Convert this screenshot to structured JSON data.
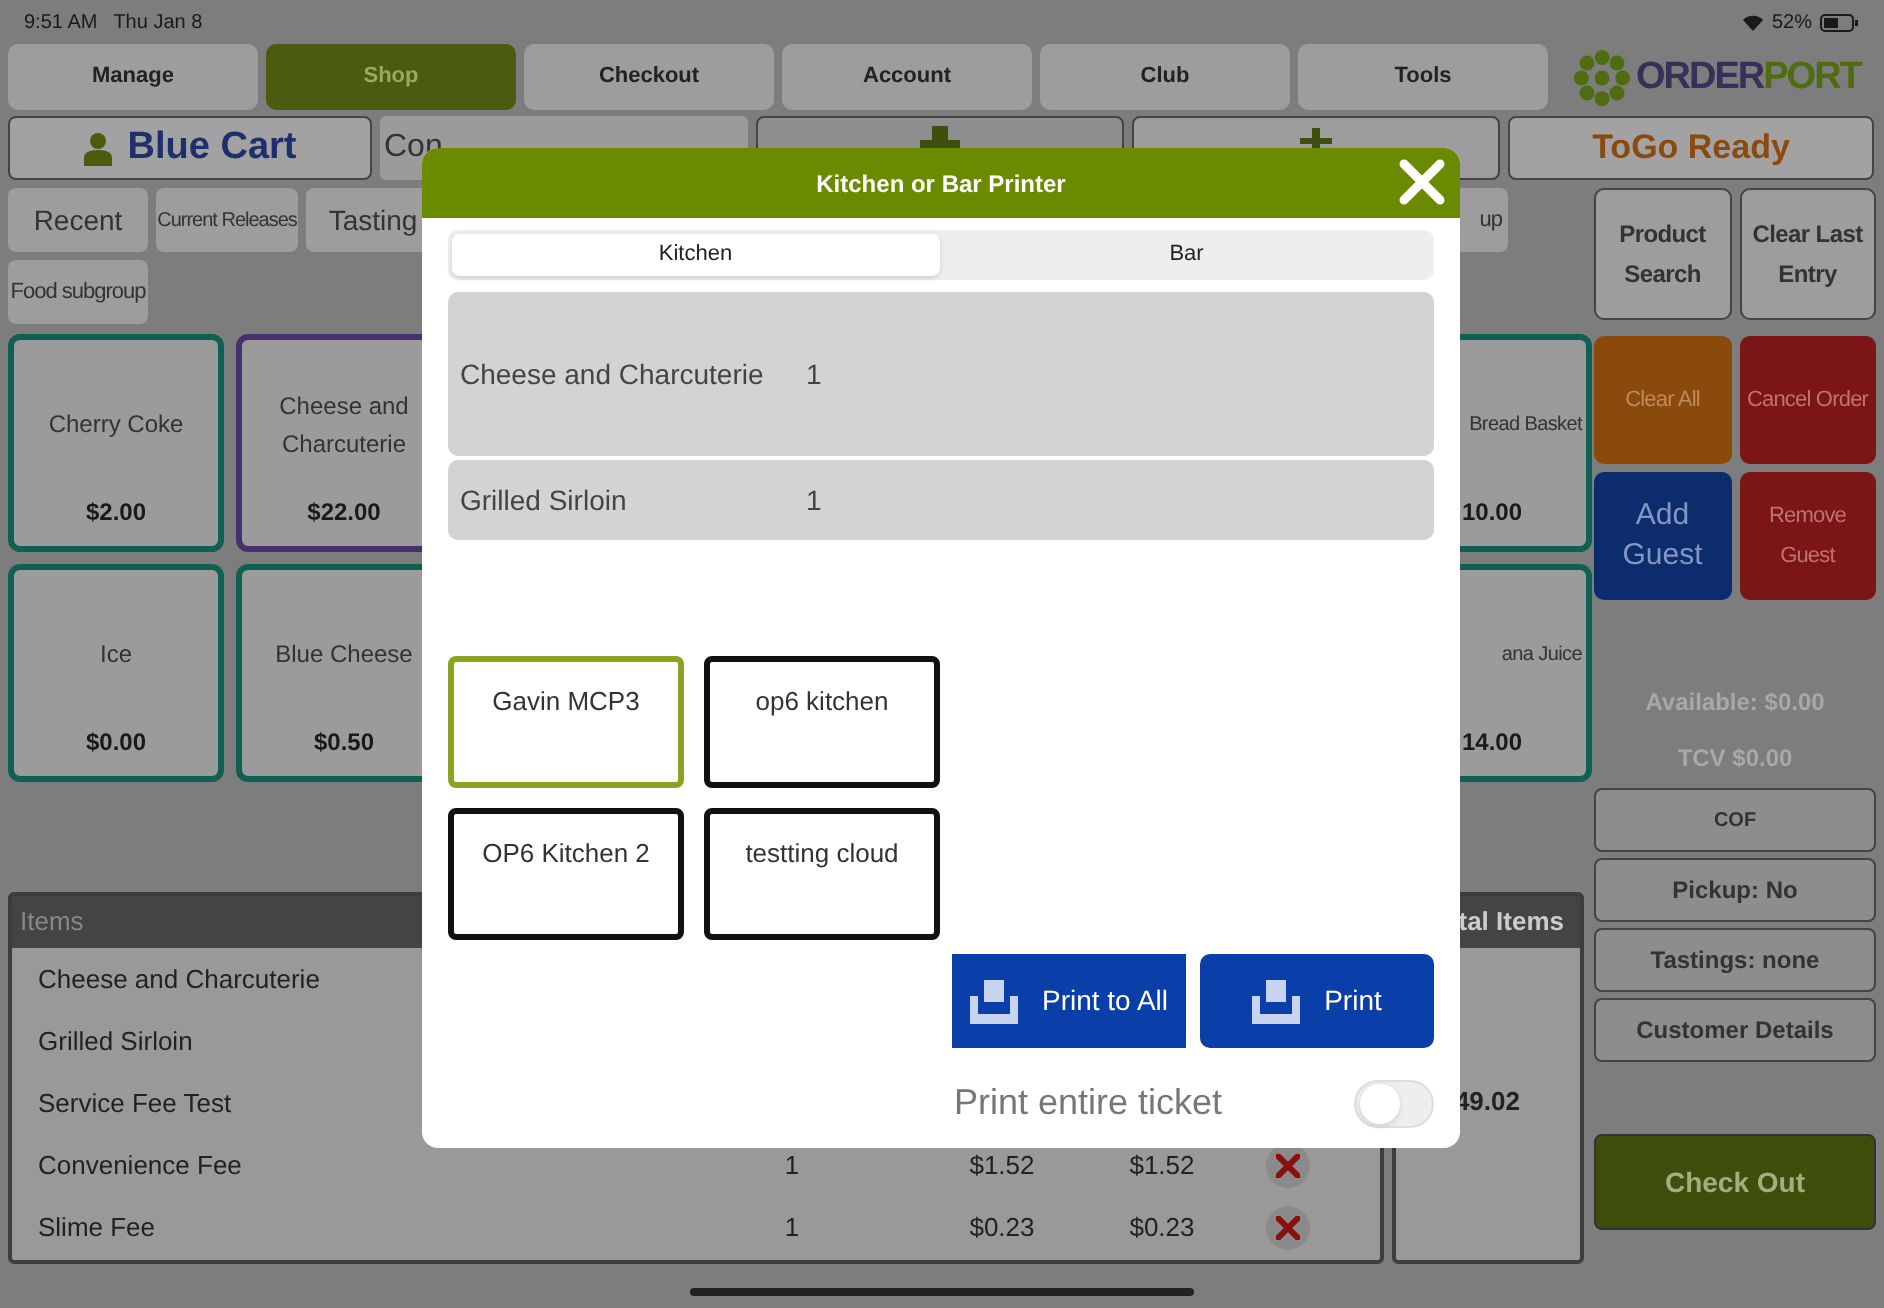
{
  "status_bar": {
    "time": "9:51 AM",
    "date": "Thu Jan 8",
    "battery": "52%"
  },
  "nav_tabs": [
    {
      "label": "Manage",
      "selected": false
    },
    {
      "label": "Shop",
      "selected": true
    },
    {
      "label": "Checkout",
      "selected": false
    },
    {
      "label": "Account",
      "selected": false
    },
    {
      "label": "Club",
      "selected": false
    },
    {
      "label": "Tools",
      "selected": false
    }
  ],
  "logo": {
    "part_1": "ORDER",
    "part_2": "PORT"
  },
  "customer_bar": {
    "cart": "Blue Cart",
    "customer_field": "Con",
    "togo": "ToGo Ready"
  },
  "categories": [
    {
      "label": "Recent"
    },
    {
      "label": "Current Releases"
    },
    {
      "label": "Tasting"
    },
    {
      "label": "up"
    },
    {
      "label": "Food subgroup"
    }
  ],
  "products": [
    {
      "name": "Cherry Coke",
      "price": "$2.00",
      "color": "#0f5f52"
    },
    {
      "name": "Cheese and Charcuterie",
      "price": "$22.00",
      "color": "#46306e"
    },
    {
      "name": "Bread Basket",
      "price": "10.00",
      "color": "#0f5f52"
    },
    {
      "name": "Ice",
      "price": "$0.00",
      "color": "#0f5f52"
    },
    {
      "name": "Blue Cheese",
      "price": "$0.50",
      "color": "#0f5f52"
    },
    {
      "name": "ana Juice",
      "price": "14.00",
      "color": "#0f5f52"
    }
  ],
  "actions": [
    {
      "label": "Product Search",
      "kind": "plain"
    },
    {
      "label": "Clear Last Entry",
      "kind": "plain"
    },
    {
      "label": "Clear All",
      "kind": "orange"
    },
    {
      "label": "Cancel Order",
      "kind": "red"
    },
    {
      "label": "Add Guest",
      "kind": "blue"
    },
    {
      "label": "Remove Guest",
      "kind": "red"
    }
  ],
  "info": [
    "Available: $0.00",
    "TCV $0.00"
  ],
  "options": [
    "COF",
    "Pickup: No",
    "Tastings: none",
    "Customer Details"
  ],
  "checkout": "Check Out",
  "items_table": {
    "header": "Items",
    "rows": [
      {
        "name": "Cheese and Charcuterie",
        "removable": false
      },
      {
        "name": "Grilled Sirloin",
        "removable": false
      },
      {
        "name": "Service Fee Test",
        "removable": false
      },
      {
        "name": "Convenience Fee",
        "qty": "1",
        "price": "$1.52",
        "total": "$1.52",
        "removable": true
      },
      {
        "name": "Slime Fee",
        "qty": "1",
        "price": "$0.23",
        "total": "$0.23",
        "removable": true
      }
    ]
  },
  "totals_panel": {
    "header": "tal Items",
    "amount": "49.02"
  },
  "dialog": {
    "title": "Kitchen or Bar Printer",
    "tabs": [
      {
        "label": "Kitchen",
        "selected": true
      },
      {
        "label": "Bar",
        "selected": false
      }
    ],
    "lines": [
      {
        "name": "Cheese and Charcuterie",
        "qty": "1"
      },
      {
        "name": "Grilled Sirloin",
        "qty": "1"
      }
    ],
    "printers": [
      {
        "name": "Gavin MCP3",
        "selected": true
      },
      {
        "name": "op6 kitchen",
        "selected": false
      },
      {
        "name": "OP6 Kitchen 2",
        "selected": false
      },
      {
        "name": "testting cloud",
        "selected": false
      }
    ],
    "buttons": [
      "Print to All",
      "Print"
    ],
    "print_entire_ticket": {
      "label": "Print entire ticket",
      "on": false
    }
  }
}
